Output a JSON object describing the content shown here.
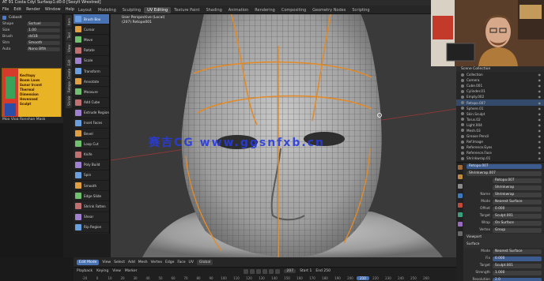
{
  "window": {
    "title": "AT  91 Costa  Cdyl Surfaop1:d0:0 [Sexylt Wrestred]"
  },
  "menu": {
    "items": [
      "File",
      "Edit",
      "Render",
      "Window",
      "Help"
    ]
  },
  "workspace_tabs": [
    "Layout",
    "Modeling",
    "Sculpting",
    "UV Editing",
    "Texture Paint",
    "Shading",
    "Animation",
    "Rendering",
    "Compositing",
    "Geometry Nodes",
    "Scripting"
  ],
  "workspace_active_index": 3,
  "left_panel": {
    "header": "Cobaslt",
    "rows": [
      {
        "label": "Shape",
        "value": "Ssrtuel"
      },
      {
        "label": "Size",
        "value": "1.00"
      },
      {
        "label": "Brush",
        "value": "dd1B"
      },
      {
        "label": "Strn",
        "value": "Smooth"
      },
      {
        "label": "Auto",
        "value": "Nono Bfth"
      }
    ],
    "poster_lines": [
      "Kecltopy",
      "Boom Laws",
      "Sunor Ircont",
      "Thermal",
      "Dimension",
      "Hevenned",
      "Sculpt"
    ],
    "bottom_label": "Moo  Vioa  Ronshan  Mask"
  },
  "side_tabs": [
    "Item",
    "Tool",
    "View",
    "Edit",
    "Create",
    "Retopo",
    "Shrink"
  ],
  "tools": [
    {
      "icon": "grab-icon",
      "label": "Brush Box",
      "active": true
    },
    {
      "icon": "cursor-icon",
      "label": "Cursor"
    },
    {
      "icon": "move-icon",
      "label": "Move"
    },
    {
      "icon": "rotate-icon",
      "label": "Rotate"
    },
    {
      "icon": "scale-icon",
      "label": "Scale"
    },
    {
      "icon": "transform-icon",
      "label": "Transform"
    },
    {
      "icon": "annotate-icon",
      "label": "Annotate"
    },
    {
      "icon": "measure-icon",
      "label": "Measure"
    },
    {
      "icon": "add-cube-icon",
      "label": "Add Cube"
    },
    {
      "icon": "extrude-icon",
      "label": "Extrude Region"
    },
    {
      "icon": "inset-icon",
      "label": "Inset Faces"
    },
    {
      "icon": "bevel-icon",
      "label": "Bevel"
    },
    {
      "icon": "loop-cut-icon",
      "label": "Loop Cut"
    },
    {
      "icon": "knife-icon",
      "label": "Knife"
    },
    {
      "icon": "poly-build-icon",
      "label": "Poly Build"
    },
    {
      "icon": "spin-icon",
      "label": "Spin"
    },
    {
      "icon": "smooth-icon",
      "label": "Smooth"
    },
    {
      "icon": "edge-slide-icon",
      "label": "Edge Slide"
    },
    {
      "icon": "shrink-icon",
      "label": "Shrink Fatten"
    },
    {
      "icon": "shear-icon",
      "label": "Shear"
    },
    {
      "icon": "rip-icon",
      "label": "Rip Region"
    }
  ],
  "viewport": {
    "info_line1": "User Perspective (Local)",
    "info_line2": "(207) Retopo001",
    "watermark": "赛吉CG   www.ggsnfxb.cn"
  },
  "viewport_header": {
    "mode": "Edit Mode",
    "items": [
      "View",
      "Select",
      "Add",
      "Mesh",
      "Vertex",
      "Edge",
      "Face",
      "UV"
    ],
    "orientation": "Global"
  },
  "timeline": {
    "menus": [
      "Playback",
      "Keying",
      "View",
      "Marker"
    ],
    "frames": [
      "-20",
      "0",
      "10",
      "20",
      "30",
      "40",
      "50",
      "60",
      "70",
      "80",
      "90",
      "100",
      "110",
      "120",
      "130",
      "140",
      "150",
      "160",
      "170",
      "180",
      "190",
      "200",
      "210",
      "220",
      "230",
      "240",
      "250",
      "260"
    ],
    "current_frame": "207",
    "start": "Start 1",
    "end": "End 250"
  },
  "outliner": {
    "header": "Scene Collection",
    "rows": [
      {
        "label": "Collection",
        "hl": false
      },
      {
        "label": "Camera",
        "hl": false
      },
      {
        "label": "Cube.001",
        "hl": false
      },
      {
        "label": "Cylinder.01",
        "hl": false
      },
      {
        "label": "Empty.002",
        "hl": false
      },
      {
        "label": "Retopo.007",
        "hl": true
      },
      {
        "label": "Sphere.01",
        "hl": false
      },
      {
        "label": "Skin.Sculpt",
        "hl": false
      },
      {
        "label": "Torus.02",
        "hl": false
      },
      {
        "label": "Light.004",
        "hl": false
      },
      {
        "label": "Mesh.03",
        "hl": false
      },
      {
        "label": "Grease Pencil",
        "hl": false
      },
      {
        "label": "Ref.Image",
        "hl": false
      },
      {
        "label": "Reference.Eyes",
        "hl": false
      },
      {
        "label": "Reference.Face",
        "hl": false
      },
      {
        "label": "Shrinkwrap.01",
        "hl": false
      }
    ]
  },
  "properties": {
    "object": "Retopo.007",
    "modifier": "Shrinkwrap.007",
    "rows": [
      {
        "label": "",
        "value": "Retopo.007"
      },
      {
        "label": "",
        "value": "Shrinkwrap"
      },
      {
        "label": "Name",
        "value": "Shrinkwrap"
      },
      {
        "label": "Mode",
        "value": "Nearest Surface"
      },
      {
        "label": "Offset",
        "value": "0.000"
      },
      {
        "label": "Target",
        "value": "Sculpt.001"
      },
      {
        "label": "Wrap",
        "value": "On Surface"
      },
      {
        "label": "Vertex",
        "value": "Group"
      }
    ],
    "sections": [
      "Viewport",
      "Surface"
    ],
    "fields2": [
      {
        "label": "Mode",
        "value": "Nearest Surface"
      },
      {
        "label": "Fix",
        "value": "0.000"
      },
      {
        "label": "Target",
        "value": "Sculpt.001"
      },
      {
        "label": "Strength",
        "value": "1.000"
      },
      {
        "label": "Resolution",
        "value": "2.0"
      }
    ]
  },
  "colors": {
    "accent": "#4772b3",
    "wire": "#e08a2a",
    "poster_yellow": "#e8b325",
    "poster_red": "#d63a2a"
  }
}
